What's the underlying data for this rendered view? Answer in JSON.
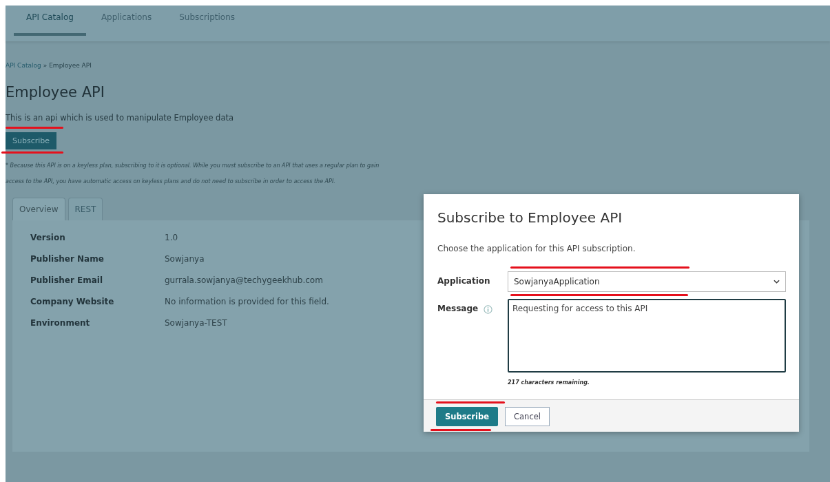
{
  "nav_tabs": [
    {
      "label": "API Catalog",
      "selected": true
    },
    {
      "label": "Applications",
      "selected": false
    },
    {
      "label": "Subscriptions",
      "selected": false
    }
  ],
  "breadcrumb": [
    {
      "label": "API Catalog",
      "link": true
    },
    {
      "label": "»",
      "link": false
    },
    {
      "label": "Employee API",
      "link": false
    }
  ],
  "title": "Employee API",
  "description": "This is an api which is used to manipulate Employee data",
  "subscribe_button": {
    "label": "Subscribe",
    "underlined": true
  },
  "note": "* Because this API is on a keyless plan, subscribing to it is optional. While you must subscribe to an API that uses a regular plan to gain access to the API, you have automatic access on keyless plans and do not need to subscribe in order to access the API.",
  "detail_tabs": [
    {
      "label": "Overview",
      "selected": true
    },
    {
      "label": "REST",
      "selected": false
    }
  ],
  "details": [
    {
      "label": "Version",
      "value": "1.0"
    },
    {
      "label": "Publisher Name",
      "value": "Sowjanya"
    },
    {
      "label": "Publisher Email",
      "value": "gurrala.sowjanya@techygeekhub.com"
    },
    {
      "label": "Company Website",
      "value": "No information is provided for this field."
    },
    {
      "label": "Environment",
      "value": "Sowjanya-TEST"
    }
  ],
  "dialog": {
    "title": "Subscribe to Employee API",
    "instruction": "Choose the application for this API subscription.",
    "application": {
      "label": "Application",
      "value": "SowjanyaApplication",
      "underlined": true
    },
    "message": {
      "label": "Message",
      "value": "Requesting for access to this API",
      "counter": "217 characters remaining."
    },
    "buttons": [
      {
        "label": "Subscribe",
        "kind": "primary",
        "underlined": true
      },
      {
        "label": "Cancel",
        "kind": "secondary",
        "underlined": false
      }
    ]
  }
}
